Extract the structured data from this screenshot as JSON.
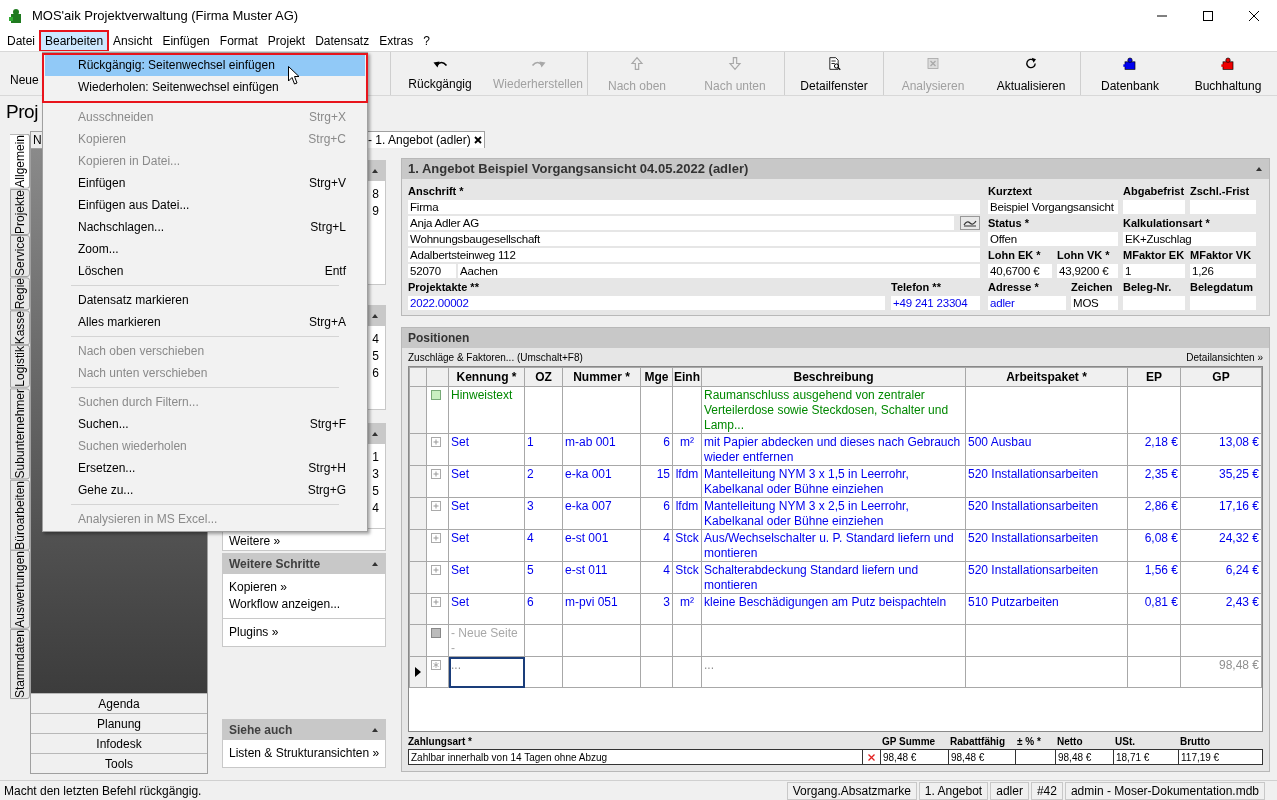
{
  "window": {
    "title": "MOS'aik Projektverwaltung (Firma Muster AG)"
  },
  "menubar": [
    {
      "label": "Datei",
      "selected": false,
      "annotated": false
    },
    {
      "label": "Bearbeiten",
      "selected": true,
      "annotated": true
    },
    {
      "label": "Ansicht",
      "selected": false,
      "annotated": false
    },
    {
      "label": "Einfügen",
      "selected": false,
      "annotated": false
    },
    {
      "label": "Format",
      "selected": false,
      "annotated": false
    },
    {
      "label": "Projekt",
      "selected": false,
      "annotated": false
    },
    {
      "label": "Datensatz",
      "selected": false,
      "annotated": false
    },
    {
      "label": "Extras",
      "selected": false,
      "annotated": false
    },
    {
      "label": "?",
      "selected": false,
      "annotated": false
    }
  ],
  "toolbar": {
    "left_label": "Neue",
    "groups": [
      [
        {
          "label": "Rückgängig",
          "kind": "undo",
          "disabled": false
        },
        {
          "label": "Wiederherstellen",
          "kind": "redo",
          "disabled": true
        }
      ],
      [
        {
          "label": "Nach oben",
          "kind": "up",
          "disabled": true
        },
        {
          "label": "Nach unten",
          "kind": "down",
          "disabled": true
        }
      ],
      [
        {
          "label": "Detailfenster",
          "kind": "detail",
          "disabled": false
        }
      ],
      [
        {
          "label": "Analysieren",
          "kind": "excel",
          "disabled": true
        },
        {
          "label": "Aktualisieren",
          "kind": "refresh",
          "disabled": false
        }
      ],
      [
        {
          "label": "Datenbank",
          "kind": "puzzle",
          "color": "#0000ee",
          "disabled": false
        },
        {
          "label": "Buchhaltung",
          "kind": "puzzle",
          "color": "#ee0000",
          "disabled": false
        }
      ]
    ]
  },
  "page_title": "Proj",
  "vertical_tabs": [
    {
      "label": "Allgemein",
      "selected": true
    },
    {
      "label": "Projekte",
      "selected": false
    },
    {
      "label": "Service",
      "selected": false
    },
    {
      "label": "Regie",
      "selected": false
    },
    {
      "label": "Kasse",
      "selected": false
    },
    {
      "label": "Logistik",
      "selected": false
    },
    {
      "label": "Subunternehmer",
      "selected": false
    },
    {
      "label": "Büroarbeiten",
      "selected": false
    },
    {
      "label": "Auswertungen",
      "selected": false
    },
    {
      "label": "Stammdaten",
      "selected": false
    }
  ],
  "document_tabs": [
    {
      "label": "N",
      "selected": false
    },
    {
      "label": "- 1. Angebot (adler)",
      "selected": true
    }
  ],
  "nav_buttons": [
    "Agenda",
    "Planung",
    "Infodesk",
    "Tools"
  ],
  "task_panel": {
    "sections": [
      {
        "groups": [
          [
            "8",
            "9"
          ]
        ]
      },
      {
        "groups": [
          [
            "4",
            "5",
            "6"
          ]
        ]
      },
      {
        "groups": [
          [
            "1",
            "3",
            "5",
            "4"
          ],
          [
            "Weitere »"
          ]
        ]
      },
      {
        "title": "Weitere Schritte",
        "groups": [
          [
            "Kopieren »",
            "Workflow anzeigen..."
          ],
          [
            "Plugins »"
          ]
        ]
      },
      {
        "title": "Siehe auch",
        "groups": [
          [
            "Listen & Strukturansichten »"
          ]
        ]
      }
    ]
  },
  "form": {
    "title": "1. Angebot Beispiel Vorgangsansicht 04.05.2022 (adler)",
    "address": {
      "label": "Anschrift *",
      "lines": [
        "Firma",
        "Anja Adler AG",
        "Wohnungsbaugesellschaft",
        "Adalbertsteinweg 112"
      ],
      "zip": "52070",
      "city": "Aachen"
    },
    "projektakte": {
      "label": "Projektakte **",
      "value": "2022.00002"
    },
    "telefon": {
      "label": "Telefon **",
      "value": "+49 241 23304"
    },
    "kurztext": {
      "label": "Kurztext",
      "value": "Beispiel Vorgangsansicht"
    },
    "abgabefrist": {
      "label": "Abgabefrist"
    },
    "zschl_frist": {
      "label": "Zschl.-Frist"
    },
    "status": {
      "label": "Status *",
      "value": "Offen"
    },
    "kalkulationsart": {
      "label": "Kalkulationsart *",
      "value": "EK+Zuschlag"
    },
    "lohn_ek": {
      "label": "Lohn EK *",
      "value": "40,6700 €"
    },
    "lohn_vk": {
      "label": "Lohn VK *",
      "value": "43,9200 €"
    },
    "mfaktor_ek": {
      "label": "MFaktor EK",
      "value": "1"
    },
    "mfaktor_vk": {
      "label": "MFaktor VK",
      "value": "1,26"
    },
    "adresse": {
      "label": "Adresse *",
      "value": "adler"
    },
    "zeichen": {
      "label": "Zeichen",
      "value": "MOS"
    },
    "beleg_nr": {
      "label": "Beleg-Nr."
    },
    "belegdatum": {
      "label": "Belegdatum"
    }
  },
  "positions": {
    "title": "Positionen",
    "toolbar_left": "Zuschläge & Faktoren... (Umschalt+F8)",
    "toolbar_right": "Detailansichten »",
    "columns": [
      "Kennung *",
      "OZ",
      "Nummer *",
      "Mge",
      "Einh",
      "Beschreibung",
      "Arbeitspaket *",
      "EP",
      "GP"
    ],
    "rows": [
      {
        "kind": "note",
        "current": false,
        "kennung": "Hinweistext",
        "beschreibung": "Raumanschluss ausgehend von zentraler Verteilerdose sowie Steckdosen, Schalter und Lamp..."
      },
      {
        "kind": "set",
        "current": false,
        "kennung": "Set",
        "oz": "1",
        "nummer": "m-ab 001",
        "mge": "6",
        "einh": "m²",
        "beschreibung": "mit Papier abdecken und dieses nach Gebrauch wieder entfernen",
        "arbeitspaket": "500 Ausbau",
        "ep": "2,18 €",
        "gp": "13,08 €"
      },
      {
        "kind": "set",
        "current": false,
        "kennung": "Set",
        "oz": "2",
        "nummer": "e-ka 001",
        "mge": "15",
        "einh": "lfdm",
        "beschreibung": "Mantelleitung NYM 3 x 1,5 in Leerrohr, Kabelkanal oder Bühne einziehen",
        "arbeitspaket": "520 Installationsarbeiten",
        "ep": "2,35 €",
        "gp": "35,25 €"
      },
      {
        "kind": "set",
        "current": false,
        "kennung": "Set",
        "oz": "3",
        "nummer": "e-ka 007",
        "mge": "6",
        "einh": "lfdm",
        "beschreibung": "Mantelleitung NYM 3 x 2,5 in Leerrohr, Kabelkanal oder Bühne einziehen",
        "arbeitspaket": "520 Installationsarbeiten",
        "ep": "2,86 €",
        "gp": "17,16 €"
      },
      {
        "kind": "set",
        "current": false,
        "kennung": "Set",
        "oz": "4",
        "nummer": "e-st 001",
        "mge": "4",
        "einh": "Stck",
        "beschreibung": "Aus/Wechselschalter u. P. Standard liefern und montieren",
        "arbeitspaket": "520 Installationsarbeiten",
        "ep": "6,08 €",
        "gp": "24,32 €"
      },
      {
        "kind": "set",
        "current": false,
        "kennung": "Set",
        "oz": "5",
        "nummer": "e-st 011",
        "mge": "4",
        "einh": "Stck",
        "beschreibung": "Schalterabdeckung Standard liefern und montieren",
        "arbeitspaket": "520 Installationsarbeiten",
        "ep": "1,56 €",
        "gp": "6,24 €"
      },
      {
        "kind": "set",
        "current": false,
        "kennung": "Set",
        "oz": "6",
        "nummer": "m-pvi 051",
        "mge": "3",
        "einh": "m²",
        "beschreibung": "kleine Beschädigungen am Putz beispachteln",
        "arbeitspaket": "510 Putzarbeiten",
        "ep": "0,81 €",
        "gp": "2,43 €"
      },
      {
        "kind": "page_break",
        "current": false,
        "kennung": "- Neue Seite -"
      },
      {
        "kind": "new",
        "current": true,
        "kennung": "...",
        "beschreibung": "...",
        "gp": "98,48 €"
      }
    ],
    "footer": {
      "payment": {
        "label": "Zahlungsart *",
        "value": "Zahlbar innerhalb von 14 Tagen ohne Abzug"
      },
      "totals": [
        {
          "label": "GP Summe",
          "value": "98,48 €"
        },
        {
          "label": "Rabattfähig",
          "value": "98,48 €"
        },
        {
          "label": "± % *"
        },
        {
          "label": "Netto",
          "value": "98,48 €"
        },
        {
          "label": "USt.",
          "value": "18,71 €"
        },
        {
          "label": "Brutto",
          "value": "117,19 €"
        }
      ]
    }
  },
  "menu": {
    "groups": [
      {
        "annotated": true,
        "items": [
          {
            "label": "Rückgängig: Seitenwechsel einfügen",
            "disabled": false,
            "selected": true
          },
          {
            "label": "Wiederholen: Seitenwechsel einfügen",
            "disabled": false,
            "selected": false
          }
        ]
      },
      {
        "annotated": false,
        "items": [
          {
            "label": "Ausschneiden",
            "shortcut": "Strg+X",
            "disabled": true,
            "selected": false
          },
          {
            "label": "Kopieren",
            "shortcut": "Strg+C",
            "disabled": true,
            "selected": false
          },
          {
            "label": "Kopieren in Datei...",
            "disabled": true,
            "selected": false
          },
          {
            "label": "Einfügen",
            "shortcut": "Strg+V",
            "disabled": false,
            "selected": false
          },
          {
            "label": "Einfügen aus Datei...",
            "disabled": false,
            "selected": false
          },
          {
            "label": "Nachschlagen...",
            "shortcut": "Strg+L",
            "disabled": false,
            "selected": false
          },
          {
            "label": "Zoom...",
            "disabled": false,
            "selected": false
          },
          {
            "label": "Löschen",
            "shortcut": "Entf",
            "disabled": false,
            "selected": false
          }
        ]
      },
      {
        "annotated": false,
        "items": [
          {
            "label": "Datensatz markieren",
            "disabled": false,
            "selected": false
          },
          {
            "label": "Alles markieren",
            "shortcut": "Strg+A",
            "disabled": false,
            "selected": false
          }
        ]
      },
      {
        "annotated": false,
        "items": [
          {
            "label": "Nach oben verschieben",
            "disabled": true,
            "selected": false
          },
          {
            "label": "Nach unten verschieben",
            "disabled": true,
            "selected": false
          }
        ]
      },
      {
        "annotated": false,
        "items": [
          {
            "label": "Suchen durch Filtern...",
            "disabled": true,
            "selected": false
          },
          {
            "label": "Suchen...",
            "shortcut": "Strg+F",
            "disabled": false,
            "selected": false
          },
          {
            "label": "Suchen wiederholen",
            "disabled": true,
            "selected": false
          },
          {
            "label": "Ersetzen...",
            "shortcut": "Strg+H",
            "disabled": false,
            "selected": false
          },
          {
            "label": "Gehe zu...",
            "shortcut": "Strg+G",
            "disabled": false,
            "selected": false
          }
        ]
      },
      {
        "annotated": false,
        "items": [
          {
            "label": "Analysieren in MS Excel...",
            "disabled": true,
            "selected": false
          }
        ]
      }
    ]
  },
  "status_bar": {
    "message": "Macht den letzten Befehl rückgängig.",
    "panes": [
      "Vorgang.Absatzmarke",
      "1. Angebot",
      "adler",
      "#42",
      "admin - Moser-Dokumentation.mdb"
    ]
  }
}
